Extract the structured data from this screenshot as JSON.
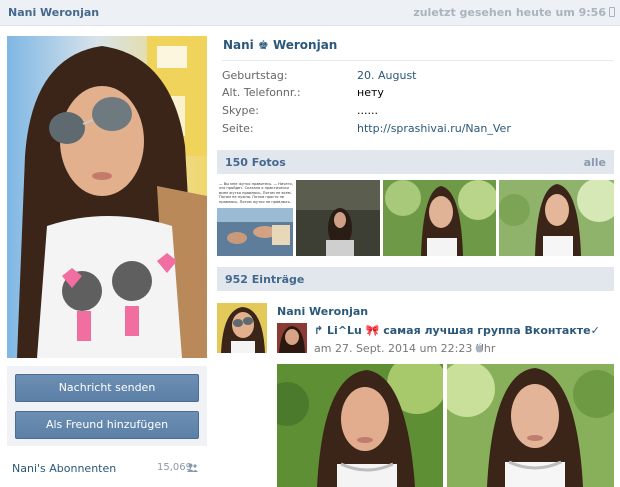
{
  "header": {
    "name": "Nani Weronjan",
    "last_seen": "zuletzt gesehen heute um 9:56"
  },
  "profile": {
    "name_first": "Nani",
    "name_last": "Weronjan",
    "info": [
      {
        "label": "Geburtstag:",
        "value": "20. August",
        "link": true
      },
      {
        "label": "Alt. Telefonnr.:",
        "value": "нету",
        "link": false
      },
      {
        "label": "Skype:",
        "value": "......",
        "link": false
      },
      {
        "label": "Seite:",
        "value": "http://sprashivai.ru/Nan_Ver",
        "link": true
      }
    ]
  },
  "buttons": {
    "send_message": "Nachricht senden",
    "add_friend": "Als Freund hinzufügen"
  },
  "subscribers": {
    "label": "Nani's Abonnenten",
    "count": "15,069"
  },
  "photos": {
    "title": "150 Fotos",
    "all": "alle",
    "thumb1_caption": "— Вы мне жутко нравитесь. — Ничего, это пройдет. Сказала я практически всем жутко нравлюсь. Потом не всем. Потом не нужно. Потом просто не нравлюсь. Потом жутко не нравлюсь."
  },
  "wall": {
    "title": "952 Einträge",
    "post": {
      "author": "Nani Weronjan",
      "repost_title": "↱ Li^Lu 🎀 самая лучшая группа Вконтакте✓",
      "date": "am 27. Sept. 2014 um 22:23 Uhr"
    }
  },
  "colors": {
    "link": "#2b587a",
    "header_bg": "#edf0f4",
    "section_bg": "#e1e7ed",
    "button": "#5e82a8"
  }
}
